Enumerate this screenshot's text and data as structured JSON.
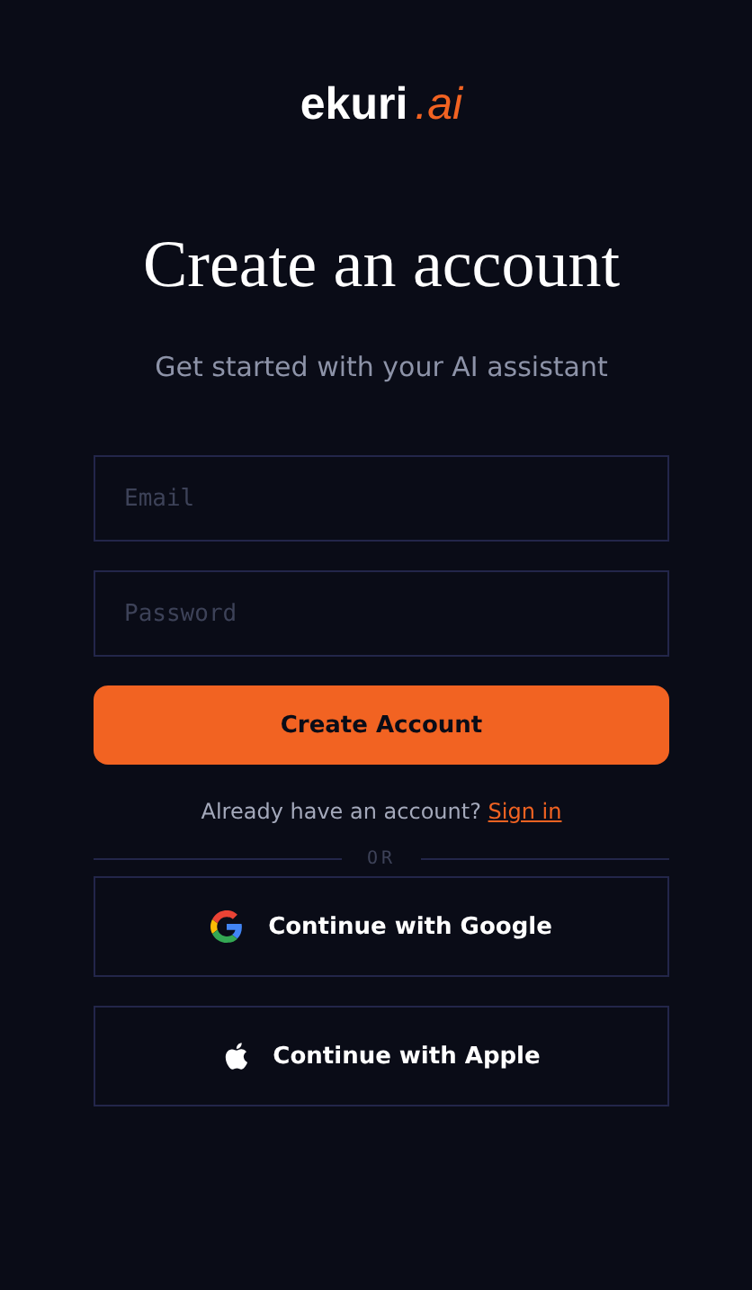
{
  "logo": {
    "name": "ekuri",
    "suffix": ".ai"
  },
  "title": "Create an account",
  "subtitle": "Get started with your AI assistant",
  "fields": [
    {
      "placeholder": "Email"
    },
    {
      "placeholder": "Password"
    }
  ],
  "submit": "Create Account",
  "signin": {
    "prompt": "Already have an account?",
    "link": "Sign in"
  },
  "divider": "OR",
  "social": [
    {
      "kind": "google",
      "label": "Continue with Google"
    },
    {
      "kind": "apple",
      "label": "Continue with Apple"
    }
  ]
}
